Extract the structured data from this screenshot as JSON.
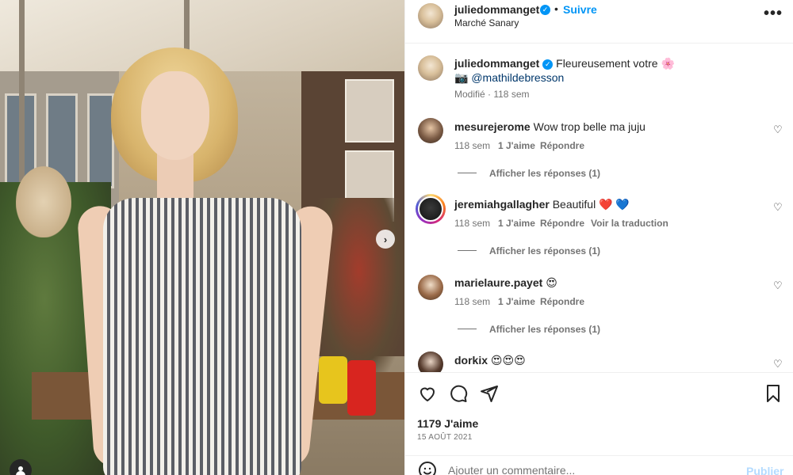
{
  "post": {
    "author": "juliedommanget",
    "location": "Marché Sanary",
    "follow_label": "Suivre",
    "separator": "•",
    "more_icon": "more-horizontal-icon",
    "caption_text": "Fleureusement votre",
    "caption_emoji": "🌸",
    "caption_tag_emoji": "📷",
    "caption_mention": "@mathildebresson",
    "caption_meta": "Modifié · 118 sem"
  },
  "comments": [
    {
      "user": "mesurejerome",
      "text": "Wow trop belle ma juju",
      "time": "118 sem",
      "likes": "1 J'aime",
      "reply": "Répondre",
      "translate": "",
      "view_replies": "Afficher les réponses (1)"
    },
    {
      "user": "jeremiahgallagher",
      "text": "Beautiful ❤️ 💙",
      "time": "118 sem",
      "likes": "1 J'aime",
      "reply": "Répondre",
      "translate": "Voir la traduction",
      "view_replies": "Afficher les réponses (1)"
    },
    {
      "user": "marielaure.payet",
      "text": "😍",
      "time": "118 sem",
      "likes": "1 J'aime",
      "reply": "Répondre",
      "translate": "",
      "view_replies": "Afficher les réponses (1)"
    },
    {
      "user": "dorkix",
      "text": "😍😍😍",
      "time": "",
      "likes": "",
      "reply": "",
      "translate": "",
      "view_replies": ""
    }
  ],
  "footer": {
    "likes": "1179 J'aime",
    "date": "15 AOÛT 2021",
    "comment_placeholder": "Ajouter un commentaire...",
    "publish_label": "Publier"
  },
  "icons": {
    "like": "heart-icon",
    "comment": "comment-icon",
    "share": "share-icon",
    "save": "bookmark-icon",
    "emoji": "emoji-icon",
    "carousel": "chevron-right-icon",
    "tag": "user-tag-icon"
  },
  "colors": {
    "accent": "#0095f6",
    "text": "#262626",
    "muted": "#737373",
    "publish_disabled": "#b3dbff"
  }
}
